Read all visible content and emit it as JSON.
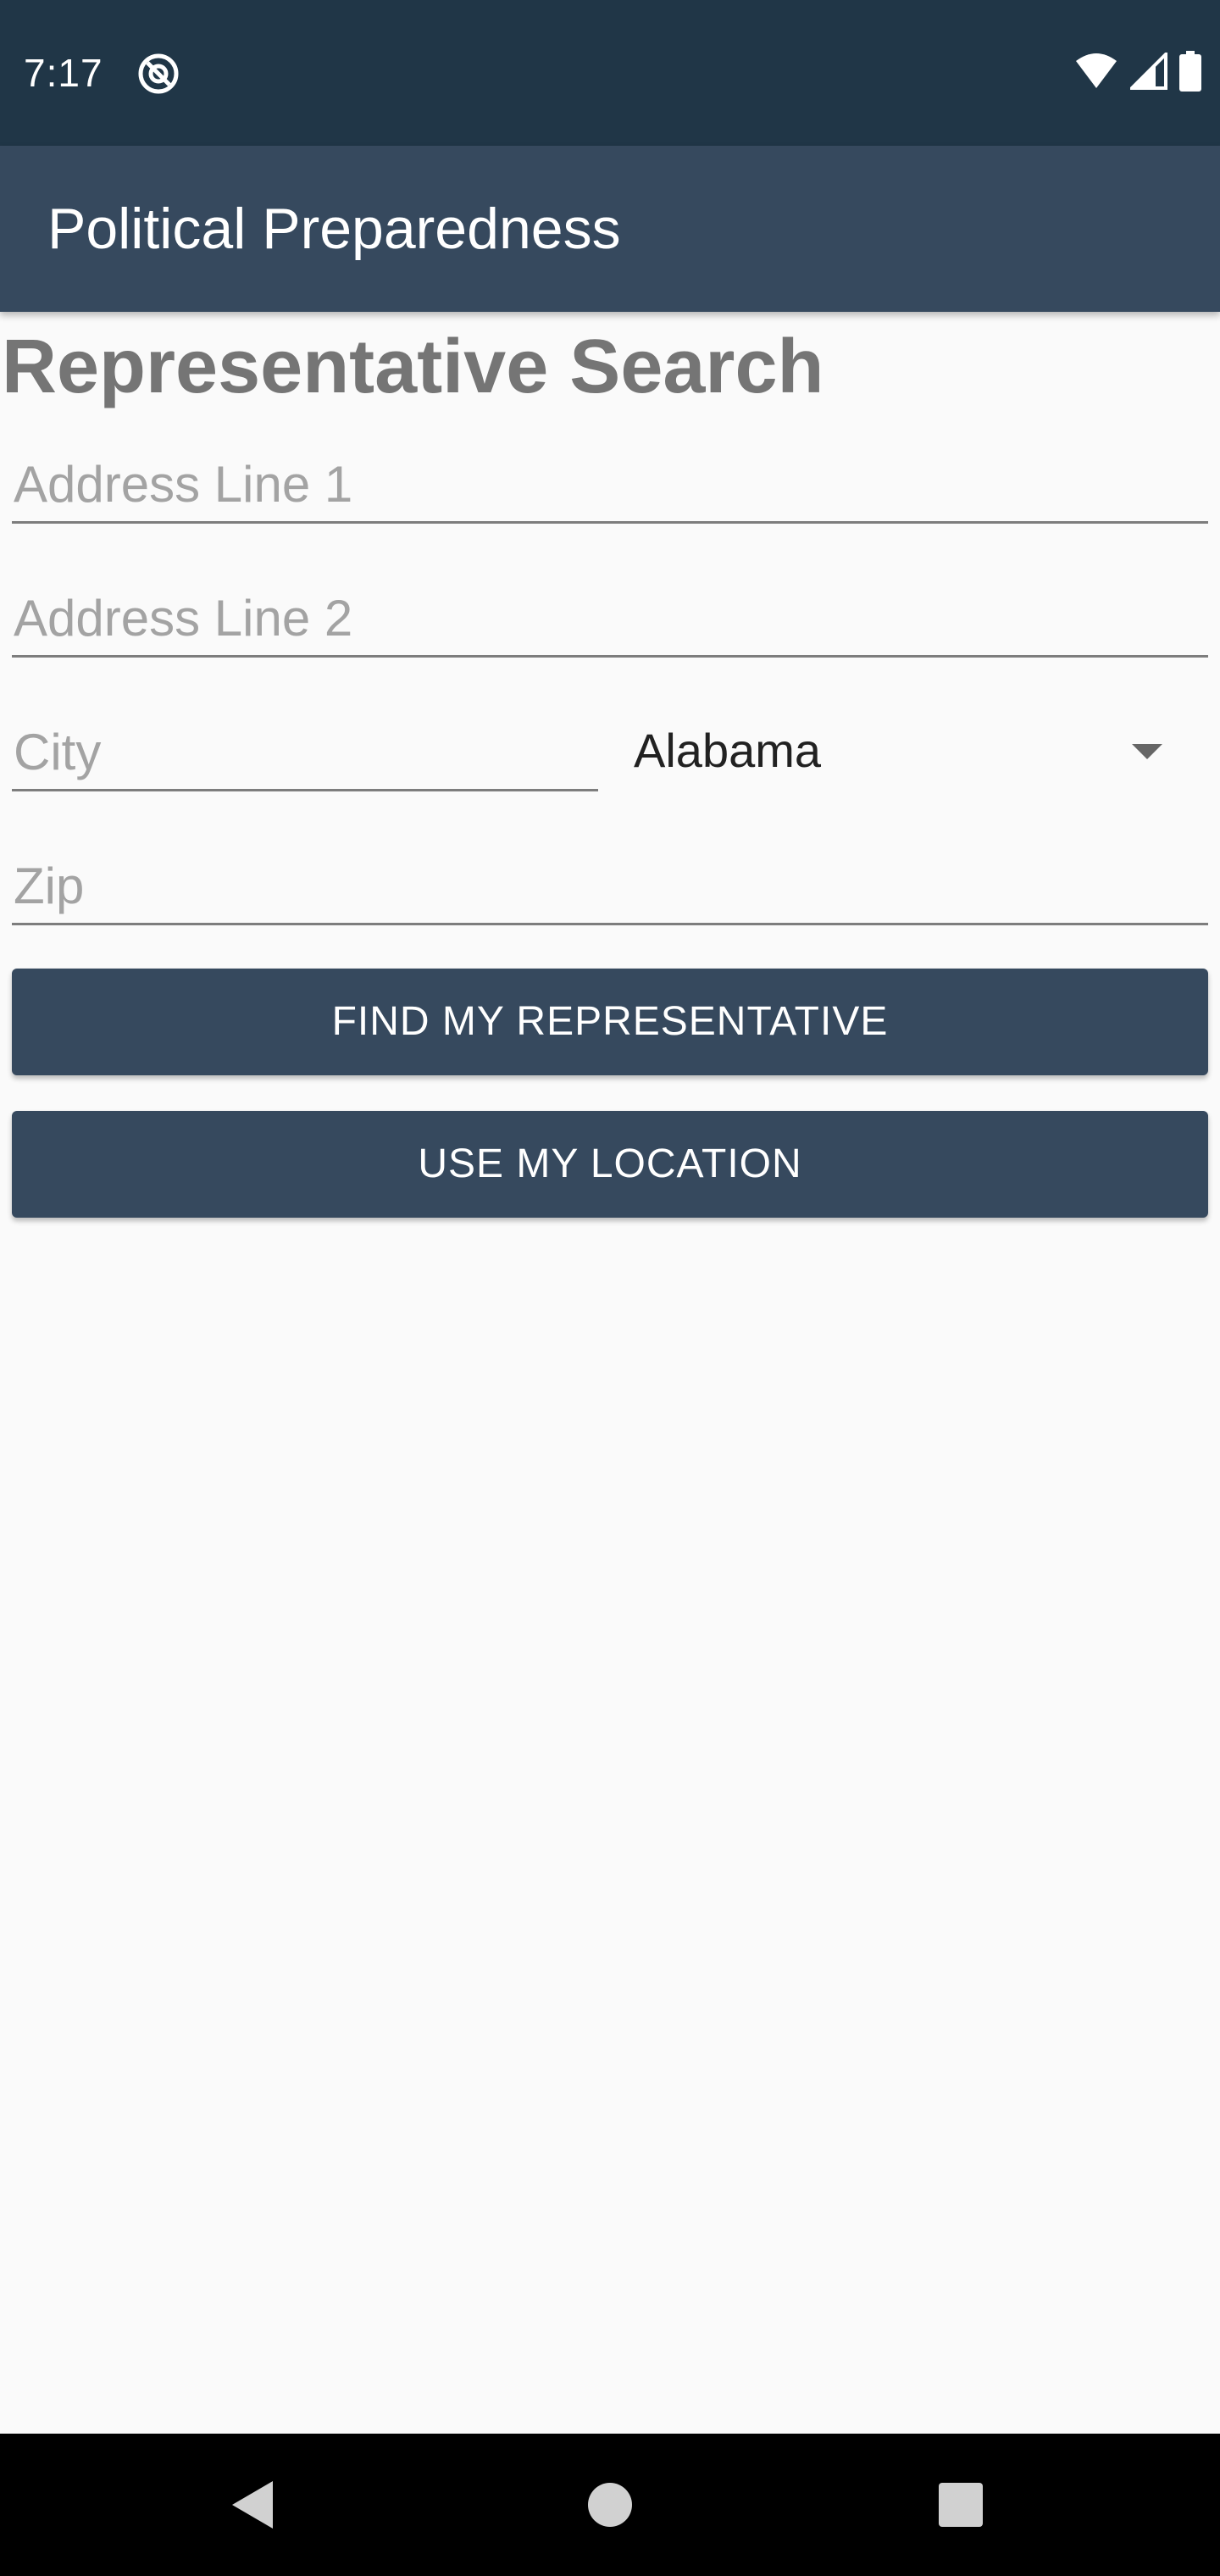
{
  "status_bar": {
    "time": "7:17",
    "icons": [
      "notification-icon",
      "wifi-icon",
      "signal-icon",
      "battery-icon"
    ]
  },
  "app_bar": {
    "title": "Political Preparedness"
  },
  "page": {
    "heading": "Representative Search"
  },
  "form": {
    "address_line_1": {
      "value": "",
      "placeholder": "Address Line 1"
    },
    "address_line_2": {
      "value": "",
      "placeholder": "Address Line 2"
    },
    "city": {
      "value": "",
      "placeholder": "City"
    },
    "state": {
      "selected": "Alabama"
    },
    "zip": {
      "value": "",
      "placeholder": "Zip"
    }
  },
  "buttons": {
    "find_label": "FIND MY REPRESENTATIVE",
    "location_label": "USE MY LOCATION"
  },
  "nav_bar": {
    "icons": [
      "back-icon",
      "home-icon",
      "recents-icon"
    ]
  },
  "colors": {
    "status_bar": "#203647",
    "primary": "#36495e",
    "background": "#fafafa",
    "heading_text": "#757575"
  }
}
